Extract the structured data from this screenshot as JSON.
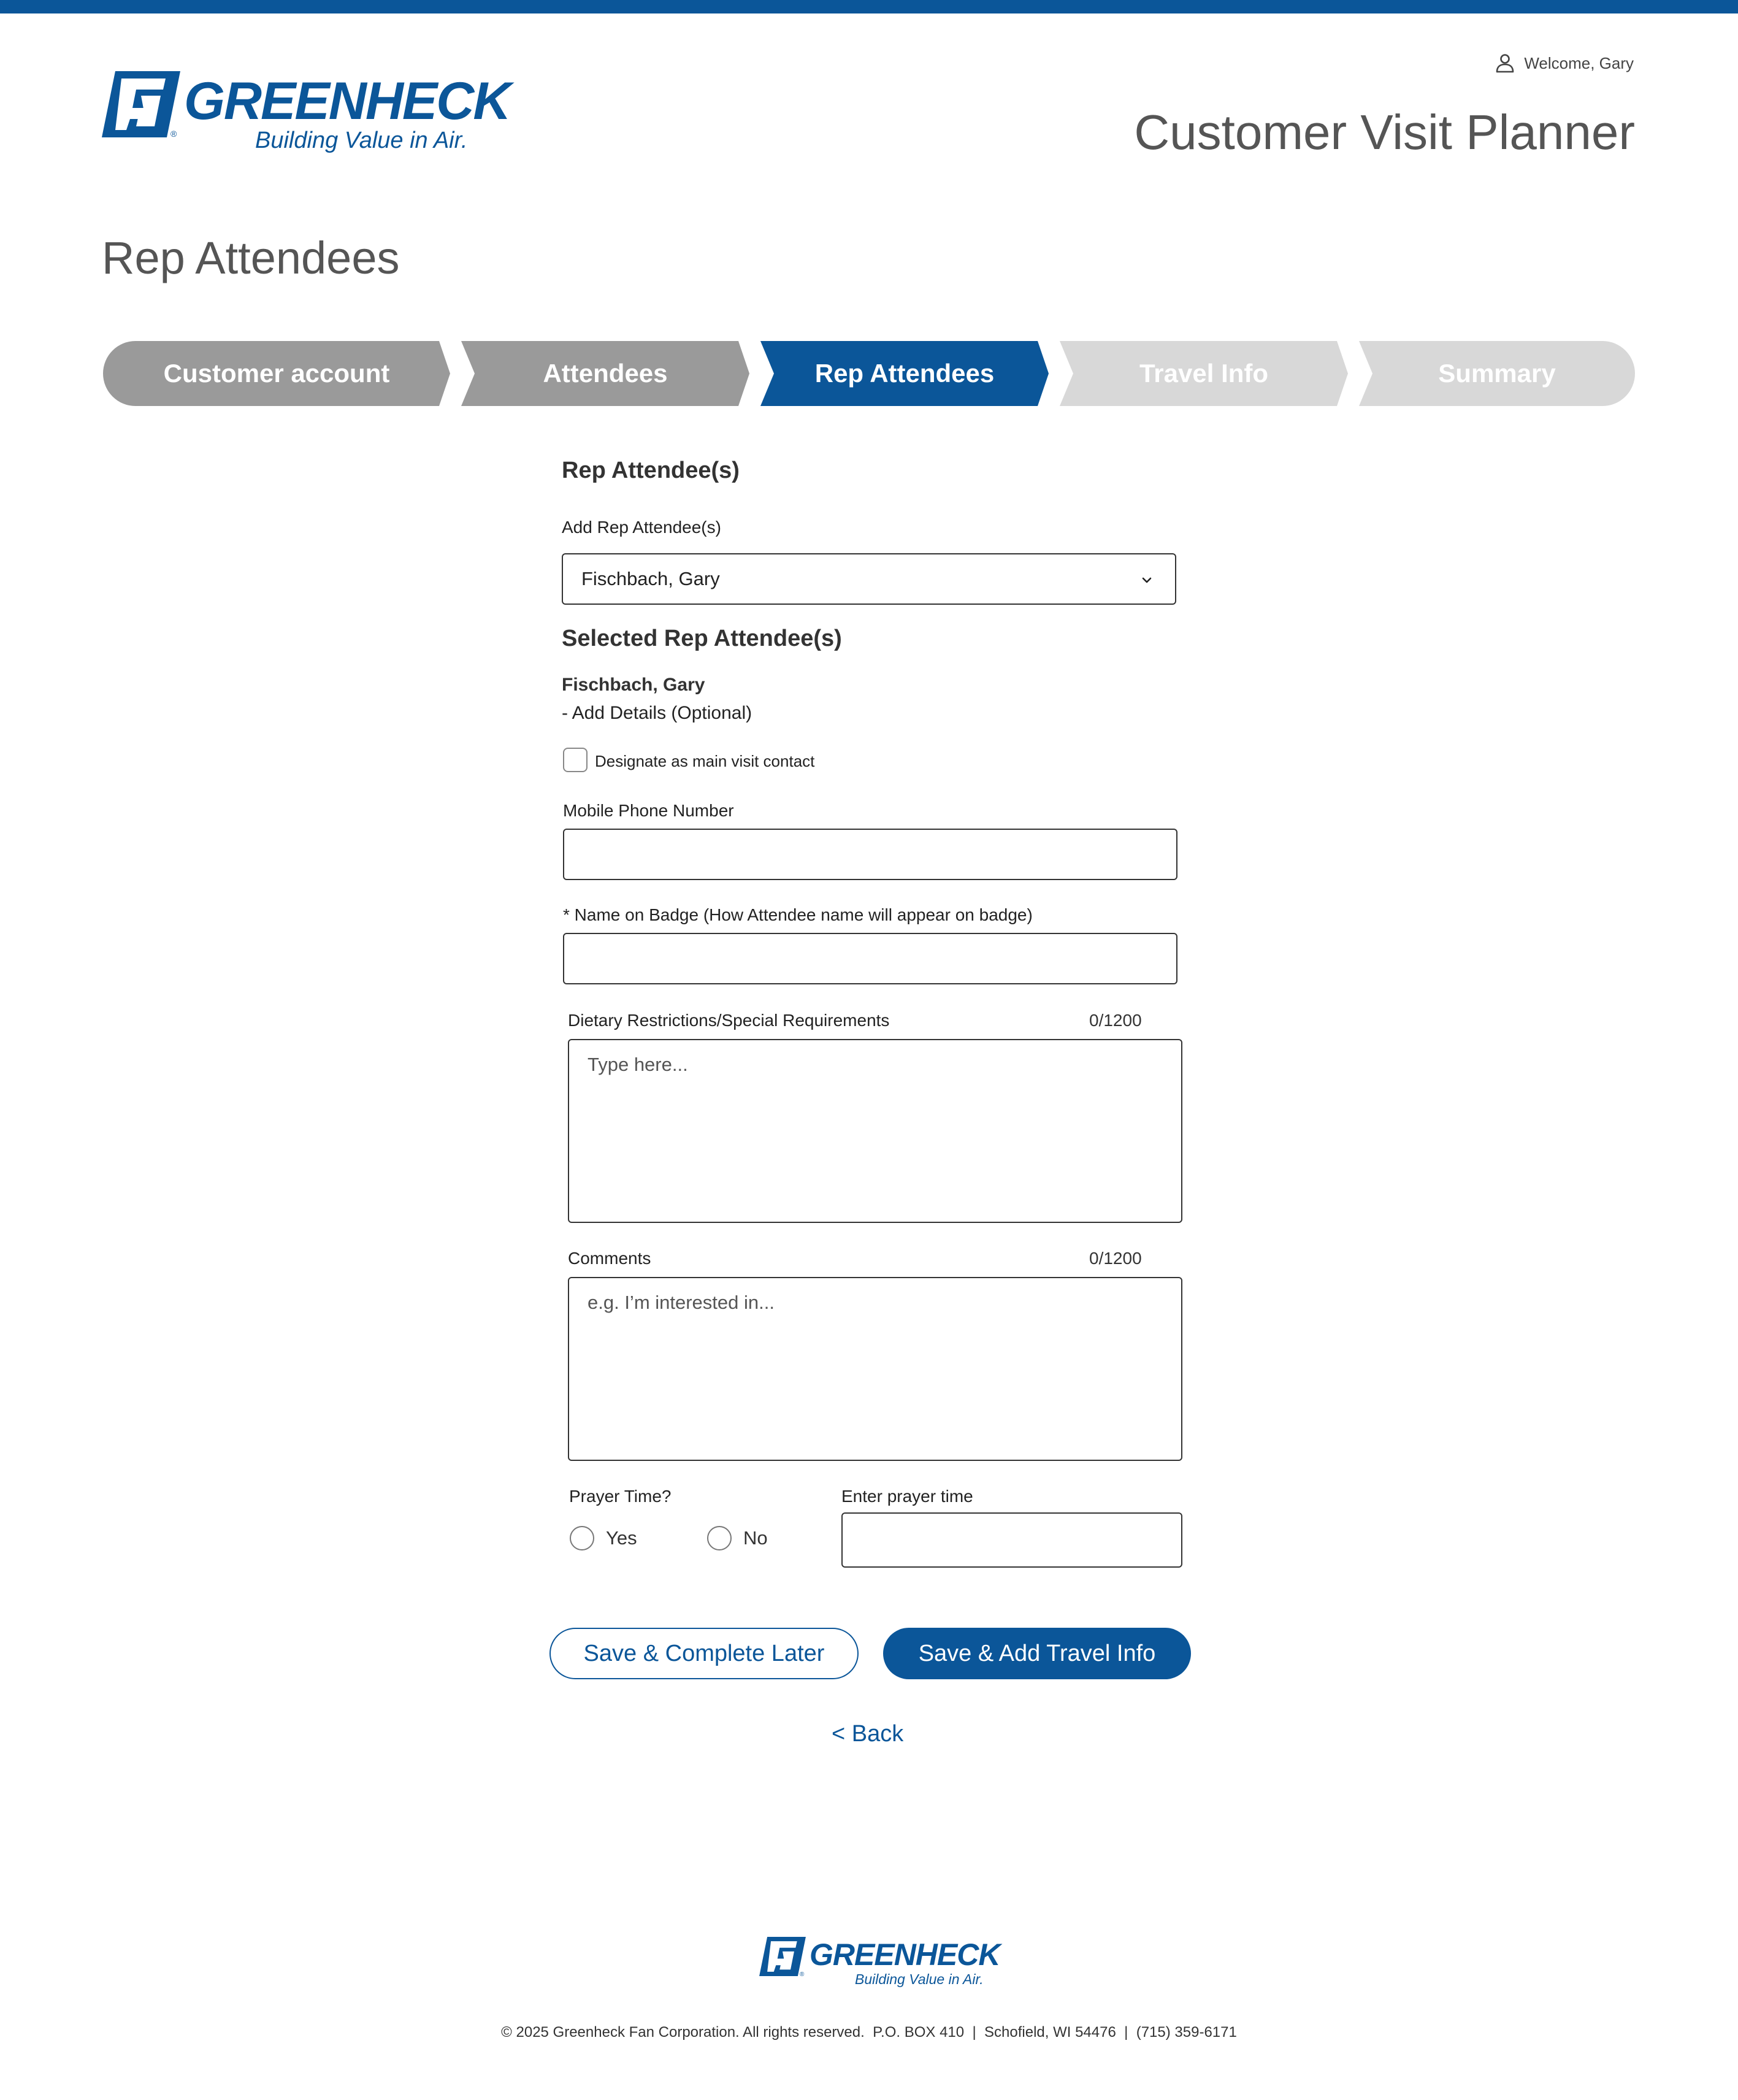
{
  "brand": {
    "name": "GREENHECK",
    "tagline": "Building Value in Air.",
    "registered": "®",
    "color": "#0b5699"
  },
  "header": {
    "welcome": "Welcome, Gary",
    "app_title": "Customer Visit Planner",
    "user_icon": "user-icon"
  },
  "page": {
    "title": "Rep Attendees"
  },
  "stepper": {
    "steps": [
      {
        "label": "Customer account",
        "state": "completed"
      },
      {
        "label": "Attendees",
        "state": "completed"
      },
      {
        "label": "Rep Attendees",
        "state": "active"
      },
      {
        "label": "Travel Info",
        "state": "upcoming"
      },
      {
        "label": "Summary",
        "state": "upcoming"
      }
    ]
  },
  "form": {
    "section_title": "Rep Attendee(s)",
    "add_label": "Add Rep Attendee(s)",
    "add_value": "Fischbach, Gary",
    "selected_title": "Selected Rep Attendee(s)",
    "selected_name": "Fischbach, Gary",
    "add_details": "-  Add Details (Optional)",
    "designate_label": "Designate as main visit contact",
    "mobile_label": "Mobile Phone Number",
    "mobile_value": "",
    "badge_label": "* Name on Badge (How Attendee name will appear on badge)",
    "badge_value": "",
    "dietary_label": "Dietary Restrictions/Special Requirements",
    "dietary_counter": "0/1200",
    "dietary_placeholder": "Type here...",
    "comments_label": "Comments",
    "comments_counter": "0/1200",
    "comments_placeholder": "e.g. I’m interested in...",
    "prayer_label": "Prayer Time?",
    "prayer_yes": "Yes",
    "prayer_no": "No",
    "prayer_time_label": "Enter prayer time",
    "prayer_time_value": ""
  },
  "actions": {
    "save_later": "Save & Complete Later",
    "save_next": "Save & Add Travel Info",
    "back": "< Back"
  },
  "footer": {
    "text": "© 2025 Greenheck Fan Corporation. All rights reserved.  P.O. BOX 410  |  Schofield, WI 54476  |  (715) 359-6171"
  }
}
